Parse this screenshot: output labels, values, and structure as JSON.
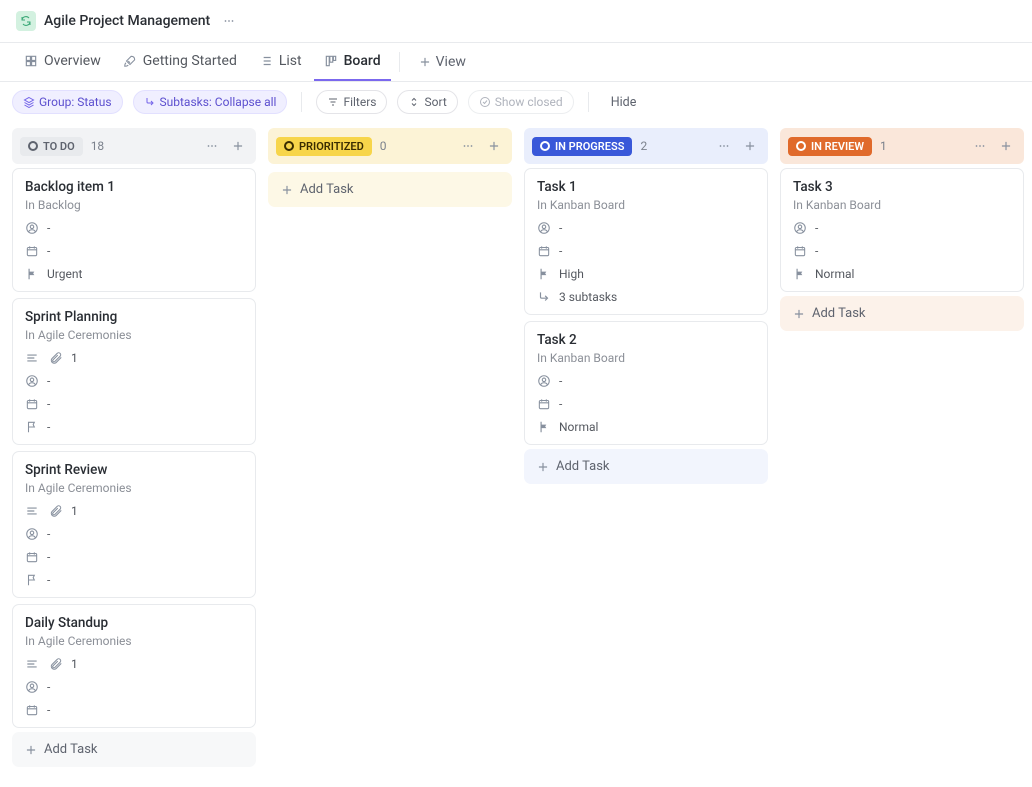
{
  "header": {
    "title": "Agile Project Management"
  },
  "tabs": [
    {
      "id": "overview",
      "label": "Overview",
      "active": false
    },
    {
      "id": "getting",
      "label": "Getting Started",
      "active": false
    },
    {
      "id": "list",
      "label": "List",
      "active": false
    },
    {
      "id": "board",
      "label": "Board",
      "active": true
    }
  ],
  "add_view_label": "View",
  "filters": {
    "group_label": "Group: Status",
    "subtasks_label": "Subtasks: Collapse all",
    "filters_label": "Filters",
    "sort_label": "Sort",
    "show_closed_label": "Show closed",
    "hide_label": "Hide"
  },
  "add_task_label": "Add Task",
  "columns": [
    {
      "id": "todo",
      "name": "TO DO",
      "count": "18",
      "chip_bg": "#e8eaed",
      "chip_fg": "#5e636e",
      "head_bg": "#f2f3f5",
      "add_bg": "#f7f8f9",
      "scroll": true,
      "cards": [
        {
          "title": "Backlog item 1",
          "sub": "In Backlog",
          "rows": [
            {
              "type": "assignee",
              "value": "-"
            },
            {
              "type": "date",
              "value": "-"
            },
            {
              "type": "flag",
              "value": "Urgent",
              "flag": "urgent"
            }
          ]
        },
        {
          "title": "Sprint Planning",
          "sub": "In Agile Ceremonies",
          "rows": [
            {
              "type": "desc-attach",
              "value": "1"
            },
            {
              "type": "assignee",
              "value": "-"
            },
            {
              "type": "date",
              "value": "-"
            },
            {
              "type": "flag",
              "value": "-",
              "flag": "low"
            }
          ]
        },
        {
          "title": "Sprint Review",
          "sub": "In Agile Ceremonies",
          "rows": [
            {
              "type": "desc-attach",
              "value": "1"
            },
            {
              "type": "assignee",
              "value": "-"
            },
            {
              "type": "date",
              "value": "-"
            },
            {
              "type": "flag",
              "value": "-",
              "flag": "low"
            }
          ]
        },
        {
          "title": "Daily Standup",
          "sub": "In Agile Ceremonies",
          "rows": [
            {
              "type": "desc-attach",
              "value": "1"
            },
            {
              "type": "assignee",
              "value": "-"
            },
            {
              "type": "date",
              "value": "-"
            }
          ]
        }
      ]
    },
    {
      "id": "prioritized",
      "name": "PRIORITIZED",
      "count": "0",
      "chip_bg": "#f7d54a",
      "chip_fg": "#3a2d00",
      "head_bg": "#fcf3d6",
      "add_bg": "#fdf8e6",
      "cards": []
    },
    {
      "id": "inprogress",
      "name": "IN PROGRESS",
      "count": "2",
      "chip_bg": "#3958d9",
      "chip_fg": "#ffffff",
      "head_bg": "#e9eefc",
      "add_bg": "#f2f5fd",
      "cards": [
        {
          "title": "Task 1",
          "sub": "In Kanban Board",
          "rows": [
            {
              "type": "assignee",
              "value": "-"
            },
            {
              "type": "date",
              "value": "-"
            },
            {
              "type": "flag",
              "value": "High",
              "flag": "high"
            },
            {
              "type": "subtasks",
              "value": "3 subtasks"
            }
          ]
        },
        {
          "title": "Task 2",
          "sub": "In Kanban Board",
          "rows": [
            {
              "type": "assignee",
              "value": "-"
            },
            {
              "type": "date",
              "value": "-"
            },
            {
              "type": "flag",
              "value": "Normal",
              "flag": "normal"
            }
          ]
        }
      ]
    },
    {
      "id": "inreview",
      "name": "IN REVIEW",
      "count": "1",
      "chip_bg": "#e06a2b",
      "chip_fg": "#ffffff",
      "head_bg": "#fae7da",
      "add_bg": "#fcf2ea",
      "cards": [
        {
          "title": "Task 3",
          "sub": "In Kanban Board",
          "rows": [
            {
              "type": "assignee",
              "value": "-"
            },
            {
              "type": "date",
              "value": "-"
            },
            {
              "type": "flag",
              "value": "Normal",
              "flag": "normal"
            }
          ]
        }
      ]
    }
  ]
}
